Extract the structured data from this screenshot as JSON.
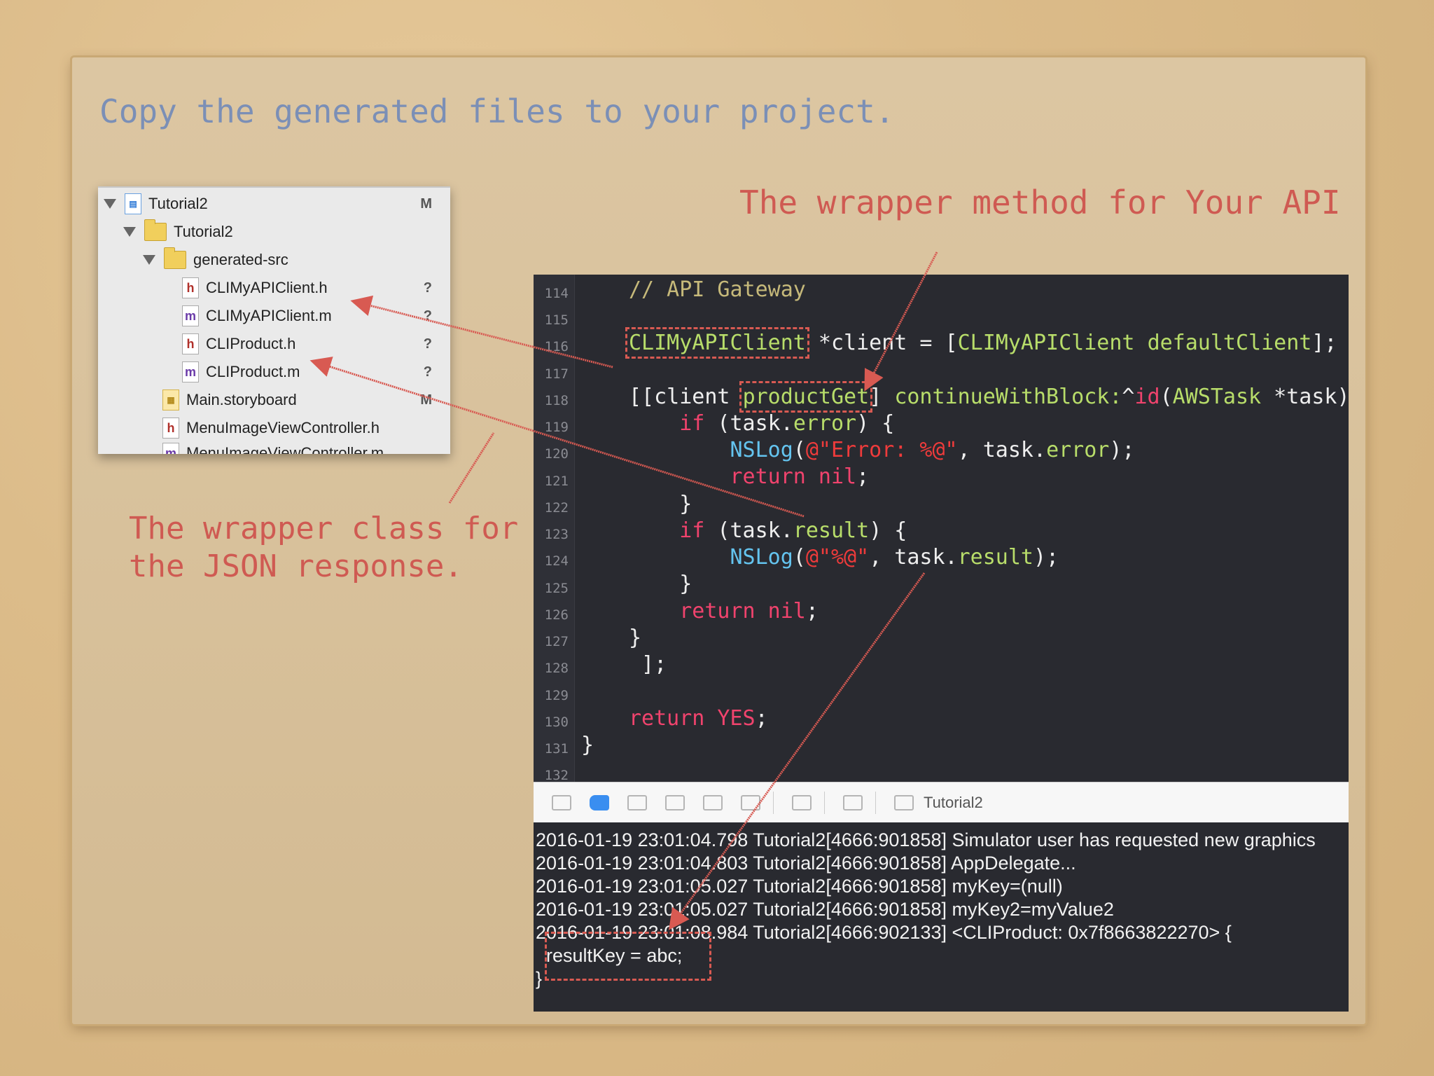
{
  "slide": {
    "heading": "Copy the generated files to your project.",
    "annotation_method": "The wrapper method for Your API",
    "annotation_class_line1": "The wrapper class for",
    "annotation_class_line2": "the JSON response."
  },
  "navigator": {
    "items": [
      {
        "label": "Tutorial2",
        "icon": "project-icon",
        "flag": "M"
      },
      {
        "label": "Tutorial2",
        "icon": "folder-icon",
        "flag": ""
      },
      {
        "label": "generated-src",
        "icon": "folder-icon",
        "flag": ""
      },
      {
        "label": "CLIMyAPIClient.h",
        "icon": "h-file-icon",
        "flag": "?"
      },
      {
        "label": "CLIMyAPIClient.m",
        "icon": "m-file-icon",
        "flag": "?"
      },
      {
        "label": "CLIProduct.h",
        "icon": "h-file-icon",
        "flag": "?"
      },
      {
        "label": "CLIProduct.m",
        "icon": "m-file-icon",
        "flag": "?"
      },
      {
        "label": "Main.storyboard",
        "icon": "storyboard-icon",
        "flag": "M"
      },
      {
        "label": "MenuImageViewController.h",
        "icon": "h-file-icon",
        "flag": ""
      },
      {
        "label": "MenuImageViewController.m",
        "icon": "m-file-icon",
        "flag": ""
      }
    ]
  },
  "editor": {
    "line_numbers": [
      "114",
      "115",
      "116",
      "117",
      "118",
      "119",
      "120",
      "121",
      "122",
      "123",
      "124",
      "125",
      "126",
      "127",
      "128",
      "129",
      "130",
      "131",
      "132"
    ]
  },
  "toolbar": {
    "target": "Tutorial2"
  },
  "console": {
    "lines": [
      "2016-01-19 23:01:04.798 Tutorial2[4666:901858] Simulator user has requested new graphics",
      "2016-01-19 23:01:04.803 Tutorial2[4666:901858] AppDelegate...",
      "2016-01-19 23:01:05.027 Tutorial2[4666:901858] myKey=(null)",
      "2016-01-19 23:01:05.027 Tutorial2[4666:901858] myKey2=myValue2",
      "2016-01-19 23:01:08.984 Tutorial2[4666:902133] <CLIProduct: 0x7f8663822270> {",
      "  resultKey = abc;",
      "}"
    ]
  },
  "colors": {
    "annotation": "#cf5a52",
    "heading": "#7b8fb6",
    "editor_bg": "#292a30"
  }
}
